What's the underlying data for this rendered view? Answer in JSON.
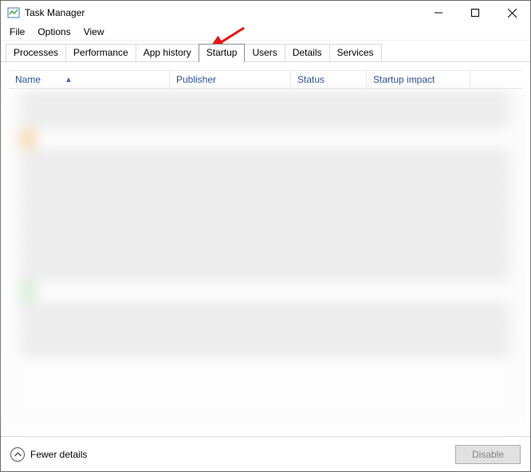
{
  "window": {
    "title": "Task Manager"
  },
  "menu": {
    "file": "File",
    "options": "Options",
    "view": "View"
  },
  "tabs": {
    "processes": "Processes",
    "performance": "Performance",
    "app_history": "App history",
    "startup": "Startup",
    "users": "Users",
    "details": "Details",
    "services": "Services"
  },
  "columns": {
    "name": "Name",
    "publisher": "Publisher",
    "status": "Status",
    "impact": "Startup impact"
  },
  "footer": {
    "fewer_label": "Fewer details",
    "disable_label": "Disable"
  }
}
